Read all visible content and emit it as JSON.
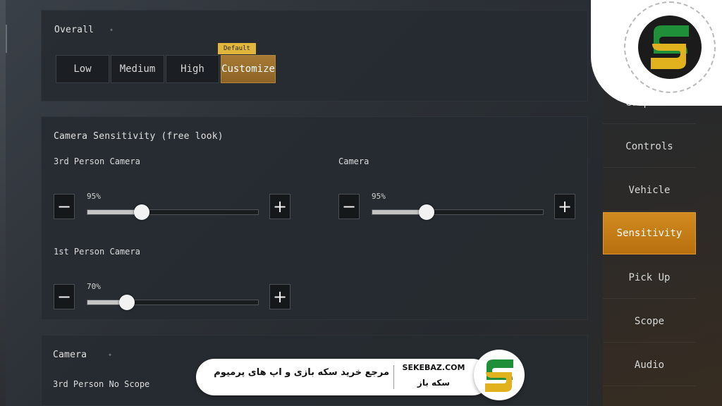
{
  "overall": {
    "title": "Overall",
    "default_badge": "Default",
    "tabs": [
      "Low",
      "Medium",
      "High",
      "Customize"
    ],
    "active_tab": "Customize"
  },
  "sensitivity": {
    "title": "Camera Sensitivity (free look)",
    "sliders": [
      {
        "label": "3rd Person Camera",
        "value_text": "95%",
        "level": 0.32
      },
      {
        "label": "Camera",
        "value_text": "95%",
        "level": 0.32
      },
      {
        "label": "1st Person Camera",
        "value_text": "70%",
        "level": 0.23
      }
    ],
    "minus": "−",
    "plus": "+"
  },
  "camera_panel": {
    "title": "Camera",
    "row_label": "3rd Person No Scope"
  },
  "nav": {
    "items": [
      "Graphics",
      "Controls",
      "Vehicle",
      "Sensitivity",
      "Pick Up",
      "Scope",
      "Audio"
    ],
    "active": "Sensitivity"
  },
  "watermark": {
    "tagline": "مرجع خرید سکه بازی و اپ های پرمیوم",
    "site": "SEKEBAZ.COM",
    "brand": "سکه باز",
    "logo_colors": {
      "green": "#1f8f3a",
      "yellow": "#e2b21e",
      "dark": "#1b1b1b"
    }
  },
  "colors": {
    "accent_active_tab": "#a77a34",
    "accent_nav_active": "#d18a1f",
    "default_badge": "#e2b53b"
  }
}
